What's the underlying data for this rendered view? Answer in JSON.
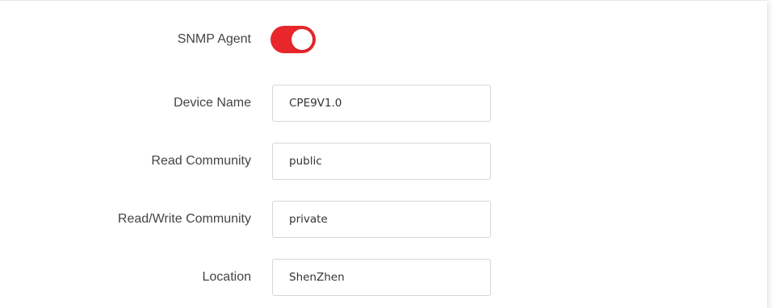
{
  "snmp_agent": {
    "label": "SNMP Agent",
    "enabled": true,
    "toggle_color": "#e8262b"
  },
  "fields": {
    "device_name": {
      "label": "Device Name",
      "value": "CPE9V1.0"
    },
    "read_community": {
      "label": "Read Community",
      "value": "public"
    },
    "read_write_community": {
      "label": "Read/Write Community",
      "value": "private"
    },
    "location": {
      "label": "Location",
      "value": "ShenZhen"
    }
  }
}
